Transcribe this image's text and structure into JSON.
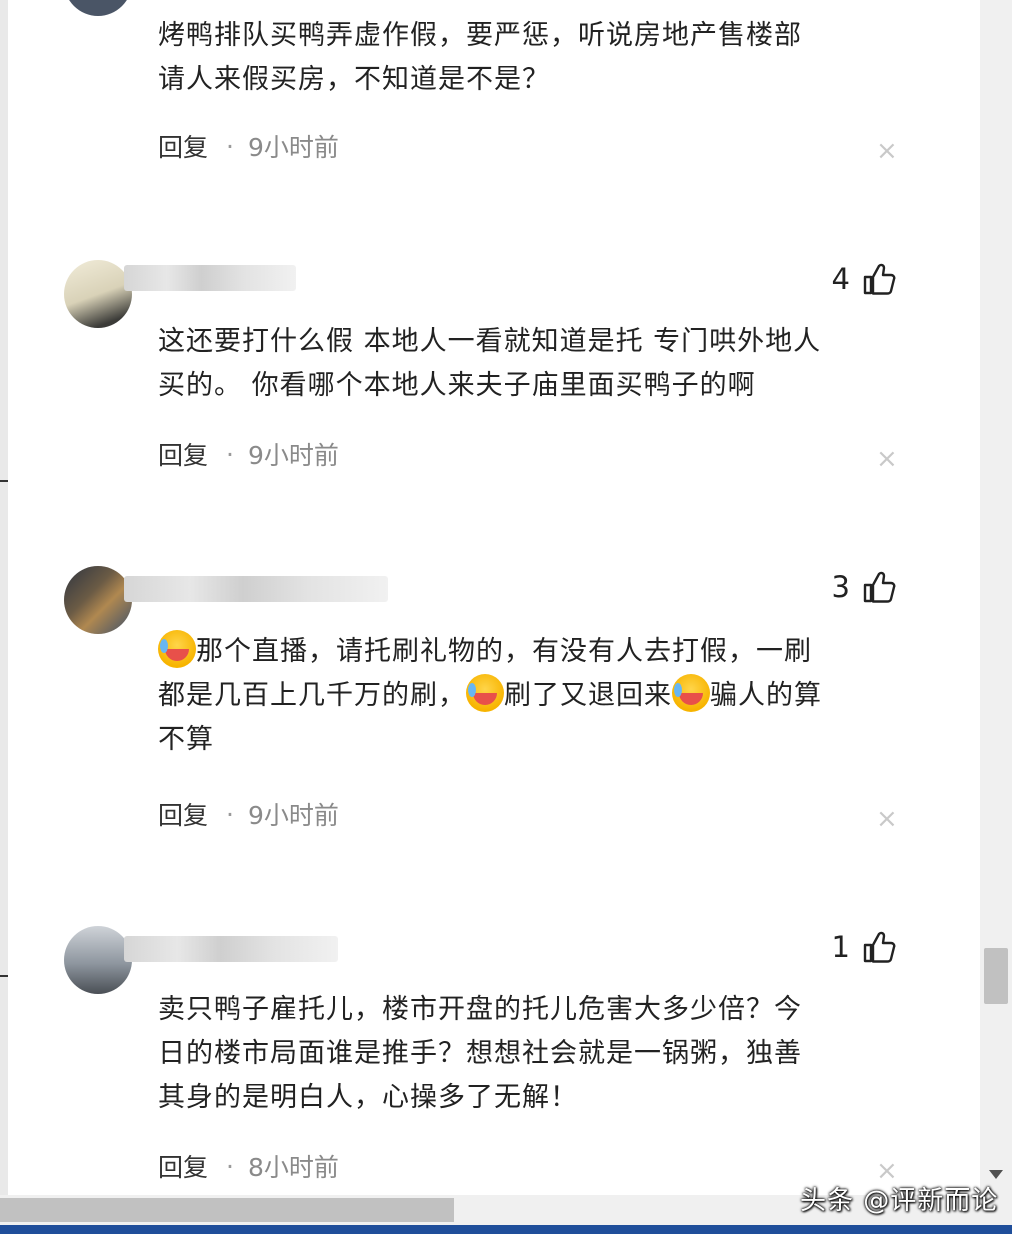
{
  "comments": [
    {
      "text_lines": [
        "烤鸭排队买鸭弄虚作假，要严惩，听说房地产售楼部",
        "请人来假买房，不知道是不是？"
      ],
      "reply_label": "回复",
      "separator": "·",
      "time": "9小时前"
    },
    {
      "likes": "4",
      "text_lines": [
        "这还要打什么假 本地人一看就知道是托 专门哄外地人",
        "买的。 你看哪个本地人来夫子庙里面买鸭子的啊"
      ],
      "reply_label": "回复",
      "separator": "·",
      "time": "9小时前"
    },
    {
      "likes": "3",
      "text_segments": [
        "那个直播，请托刷礼物的，有没有人去打假，一刷",
        "都是几百上几千万的刷，",
        "刷了又退回来",
        "骗人的算",
        "不算"
      ],
      "reply_label": "回复",
      "separator": "·",
      "time": "9小时前"
    },
    {
      "likes": "1",
      "text_lines": [
        "卖只鸭子雇托儿，楼市开盘的托儿危害大多少倍？今",
        "日的楼市局面谁是推手？想想社会就是一锅粥，独善",
        "其身的是明白人，心操多了无解！"
      ],
      "reply_label": "回复",
      "separator": "·",
      "time": "8小时前"
    }
  ],
  "close_symbol": "×",
  "watermark": "头条 @评新而论",
  "icons": {
    "like": "thumbs-up-icon",
    "emoji": "laughing-crying-emoji-icon",
    "close": "close-icon"
  },
  "colors": {
    "text": "#222222",
    "time": "#8a8a8a",
    "close": "#c9c9c9",
    "emoji": "#f7b400"
  }
}
